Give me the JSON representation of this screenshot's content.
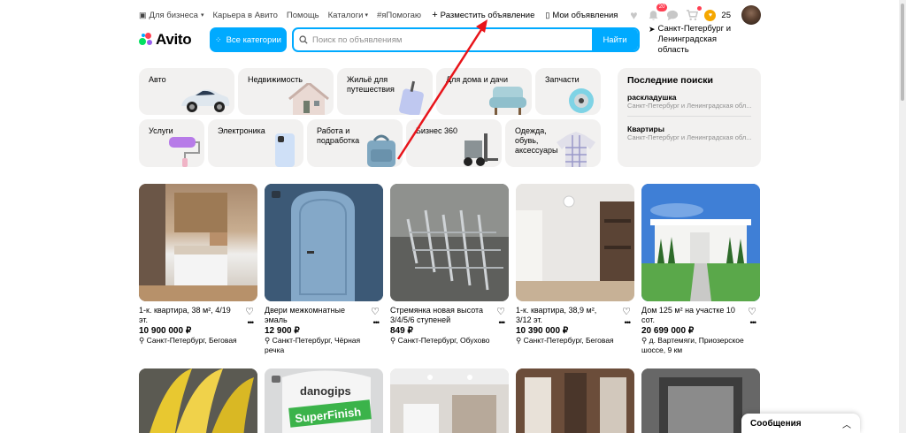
{
  "topbar": {
    "business": "Для бизнеса",
    "career": "Карьера в Авито",
    "help": "Помощь",
    "catalogs": "Каталоги",
    "help_tag": "#яПомогаю",
    "post_ad": "Разместить объявление",
    "my_ads": "Мои объявления",
    "notifications_count": "20",
    "bonus_points": "25"
  },
  "header": {
    "logo": "Avito",
    "all_categories": "Все категории",
    "search_placeholder": "Поиск по объявлениям",
    "search_button": "Найти",
    "location": "Санкт-Петербург и Ленинградская область"
  },
  "categories": [
    {
      "label": "Авто"
    },
    {
      "label": "Недвижимость"
    },
    {
      "label": "Жильё для путешествия"
    },
    {
      "label": "Для дома и дачи"
    },
    {
      "label": "Запчасти"
    },
    {
      "label": "Услуги"
    },
    {
      "label": "Электроника"
    },
    {
      "label": "Работа и подработка"
    },
    {
      "label": "Бизнес 360"
    },
    {
      "label": "Одежда, обувь, аксессуары"
    }
  ],
  "recent": {
    "title": "Последние поиски",
    "items": [
      {
        "query": "раскладушка",
        "region": "Санкт-Петербург и Ленинградская обл..."
      },
      {
        "query": "Квартиры",
        "region": "Санкт-Петербург и Ленинградская обл..."
      }
    ]
  },
  "listings": [
    {
      "title": "1-к. квартира, 38 м², 4/19 эт.",
      "price": "10 900 000 ₽",
      "address": "Санкт-Петербург, Беговая"
    },
    {
      "title": "Двери межкомнатные эмаль",
      "price": "12 900 ₽",
      "address": "Санкт-Петербург, Чёрная речка"
    },
    {
      "title": "Стремянка новая высота 3/4/5/6 ступеней",
      "price": "849 ₽",
      "address": "Санкт-Петербург, Обухово"
    },
    {
      "title": "1-к. квартира, 38,9 м², 3/12 эт.",
      "price": "10 390 000 ₽",
      "address": "Санкт-Петербург, Беговая"
    },
    {
      "title": "Дом 125 м² на участке 10 сот.",
      "price": "20 699 000 ₽",
      "address": "д. Вартемяги, Приозерское шоссе, 9 км"
    }
  ],
  "messages": {
    "label": "Сообщения"
  },
  "colors": {
    "accent": "#00aaff",
    "annotation": "#e8141a"
  }
}
